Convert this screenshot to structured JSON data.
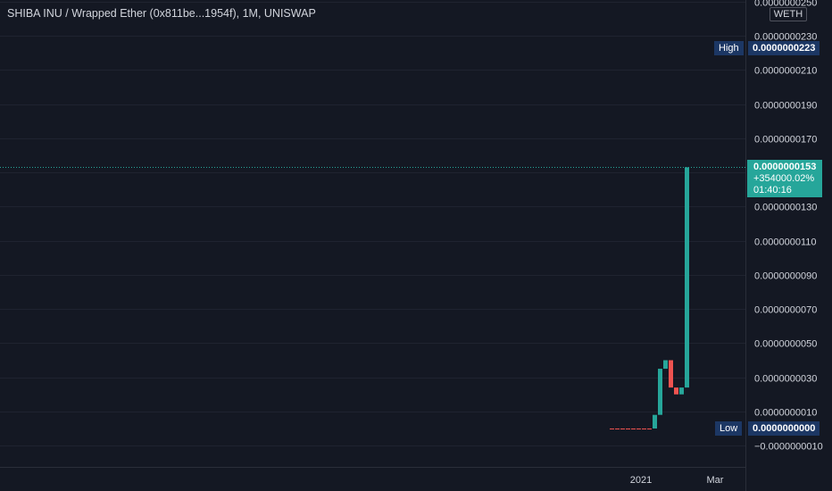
{
  "header": {
    "symbol": "SHIBA INU / Wrapped Ether (0x811be...1954f)",
    "interval": "1M",
    "exchange": "UNISWAP",
    "separator": ", "
  },
  "price_axis": {
    "currency": "WETH",
    "tick_labels": [
      "0.0000000250",
      "0.0000000230",
      "0.0000000210",
      "0.0000000190",
      "0.0000000170",
      "0.0000000150",
      "0.0000000130",
      "0.0000000110",
      "0.0000000090",
      "0.0000000070",
      "0.0000000050",
      "0.0000000030",
      "0.0000000010",
      "−0.0000000010"
    ]
  },
  "markers": {
    "high_label": "High",
    "high_value": "0.0000000223",
    "low_label": "Low",
    "low_value": "0.0000000000"
  },
  "last_price": {
    "price": "0.0000000153",
    "change": "+354000.02%",
    "countdown": "01:40:16"
  },
  "time_axis": {
    "labels": [
      "2021",
      "Mar"
    ]
  },
  "colors": {
    "background": "#141823",
    "grid": "#1f2330",
    "up": "#26a69a",
    "down": "#ef5350",
    "tag": "#1c3764"
  },
  "chart_data": {
    "type": "candlestick",
    "title": "SHIBA INU / Wrapped Ether (0x811be...1954f), 1M, UNISWAP",
    "y_unit": "WETH",
    "ylim": [
      -2e-09,
      2.5e-08
    ],
    "ticks": [
      2.5e-08,
      2.3e-08,
      2.1e-08,
      1.9e-08,
      1.7e-08,
      1.5e-08,
      1.3e-08,
      1.1e-08,
      9e-09,
      7e-09,
      5e-09,
      3e-09,
      1e-09,
      -1e-09
    ],
    "x_labels": [
      "2021",
      "Mar"
    ],
    "grid": true,
    "high": 2.23e-08,
    "low": 0.0,
    "last": 1.53e-08,
    "candles": [
      {
        "open": 0.0,
        "close": 0.0,
        "high": 0.0,
        "low": 0.0
      },
      {
        "open": 0.0,
        "close": 0.0,
        "high": 0.0,
        "low": 0.0
      },
      {
        "open": 0.0,
        "close": 0.0,
        "high": 0.0,
        "low": 0.0
      },
      {
        "open": 0.0,
        "close": 0.0,
        "high": 0.0,
        "low": 0.0
      },
      {
        "open": 0.0,
        "close": 0.0,
        "high": 0.0,
        "low": 0.0
      },
      {
        "open": 0.0,
        "close": 0.0,
        "high": 0.0,
        "low": 0.0
      },
      {
        "open": 0.0,
        "close": 0.0,
        "high": 0.0,
        "low": 0.0
      },
      {
        "open": 0.0,
        "close": 0.0,
        "high": 0.0,
        "low": 0.0
      },
      {
        "open": 0.0,
        "close": 8e-10,
        "high": 8e-10,
        "low": 0.0
      },
      {
        "open": 8e-10,
        "close": 3.5e-09,
        "high": 3.5e-09,
        "low": 8e-10
      },
      {
        "open": 3.5e-09,
        "close": 4e-09,
        "high": 4e-09,
        "low": 3.5e-09
      },
      {
        "open": 4e-09,
        "close": 2.4e-09,
        "high": 4e-09,
        "low": 2.4e-09
      },
      {
        "open": 2.4e-09,
        "close": 2e-09,
        "high": 2.4e-09,
        "low": 2e-09
      },
      {
        "open": 2e-09,
        "close": 2.4e-09,
        "high": 2.4e-09,
        "low": 2e-09
      },
      {
        "open": 2.4e-09,
        "close": 1.53e-08,
        "high": 1.53e-08,
        "low": 2.4e-09
      }
    ]
  }
}
